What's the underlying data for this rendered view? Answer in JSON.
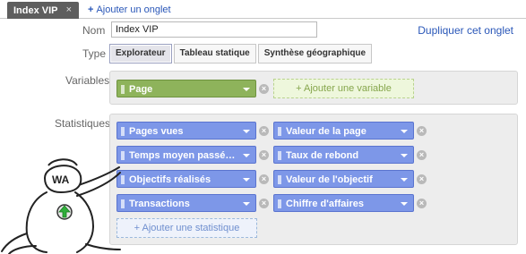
{
  "tabs": {
    "active_label": "Index VIP",
    "close_glyph": "×",
    "add_label": "Ajouter un onglet",
    "add_glyph": "+"
  },
  "form": {
    "name_label": "Nom",
    "name_value": "Index VIP",
    "duplicate_link": "Dupliquer cet onglet",
    "type_label": "Type",
    "type_options": [
      "Explorateur",
      "Tableau statique",
      "Synthèse géographique"
    ],
    "type_selected": "Explorateur",
    "variables_label": "Variables",
    "stats_label": "Statistiques"
  },
  "variables": {
    "items": [
      {
        "label": "Page"
      }
    ],
    "add_label": "+ Ajouter une variable"
  },
  "statistics": {
    "left": [
      {
        "label": "Pages vues"
      },
      {
        "label": "Temps moyen passé sur la page"
      },
      {
        "label": "Objectifs réalisés"
      },
      {
        "label": "Transactions"
      }
    ],
    "right": [
      {
        "label": "Valeur de la page"
      },
      {
        "label": "Taux de rebond"
      },
      {
        "label": "Valeur de l'objectif"
      },
      {
        "label": "Chiffre d'affaires"
      }
    ],
    "add_label": "+ Ajouter une statistique"
  },
  "mascot": {
    "badge_text": "WA"
  },
  "colors": {
    "variable_chip": "#8eb35b",
    "metric_chip": "#7d97e8",
    "link": "#2a57b8",
    "active_tab": "#5e5e5e"
  }
}
